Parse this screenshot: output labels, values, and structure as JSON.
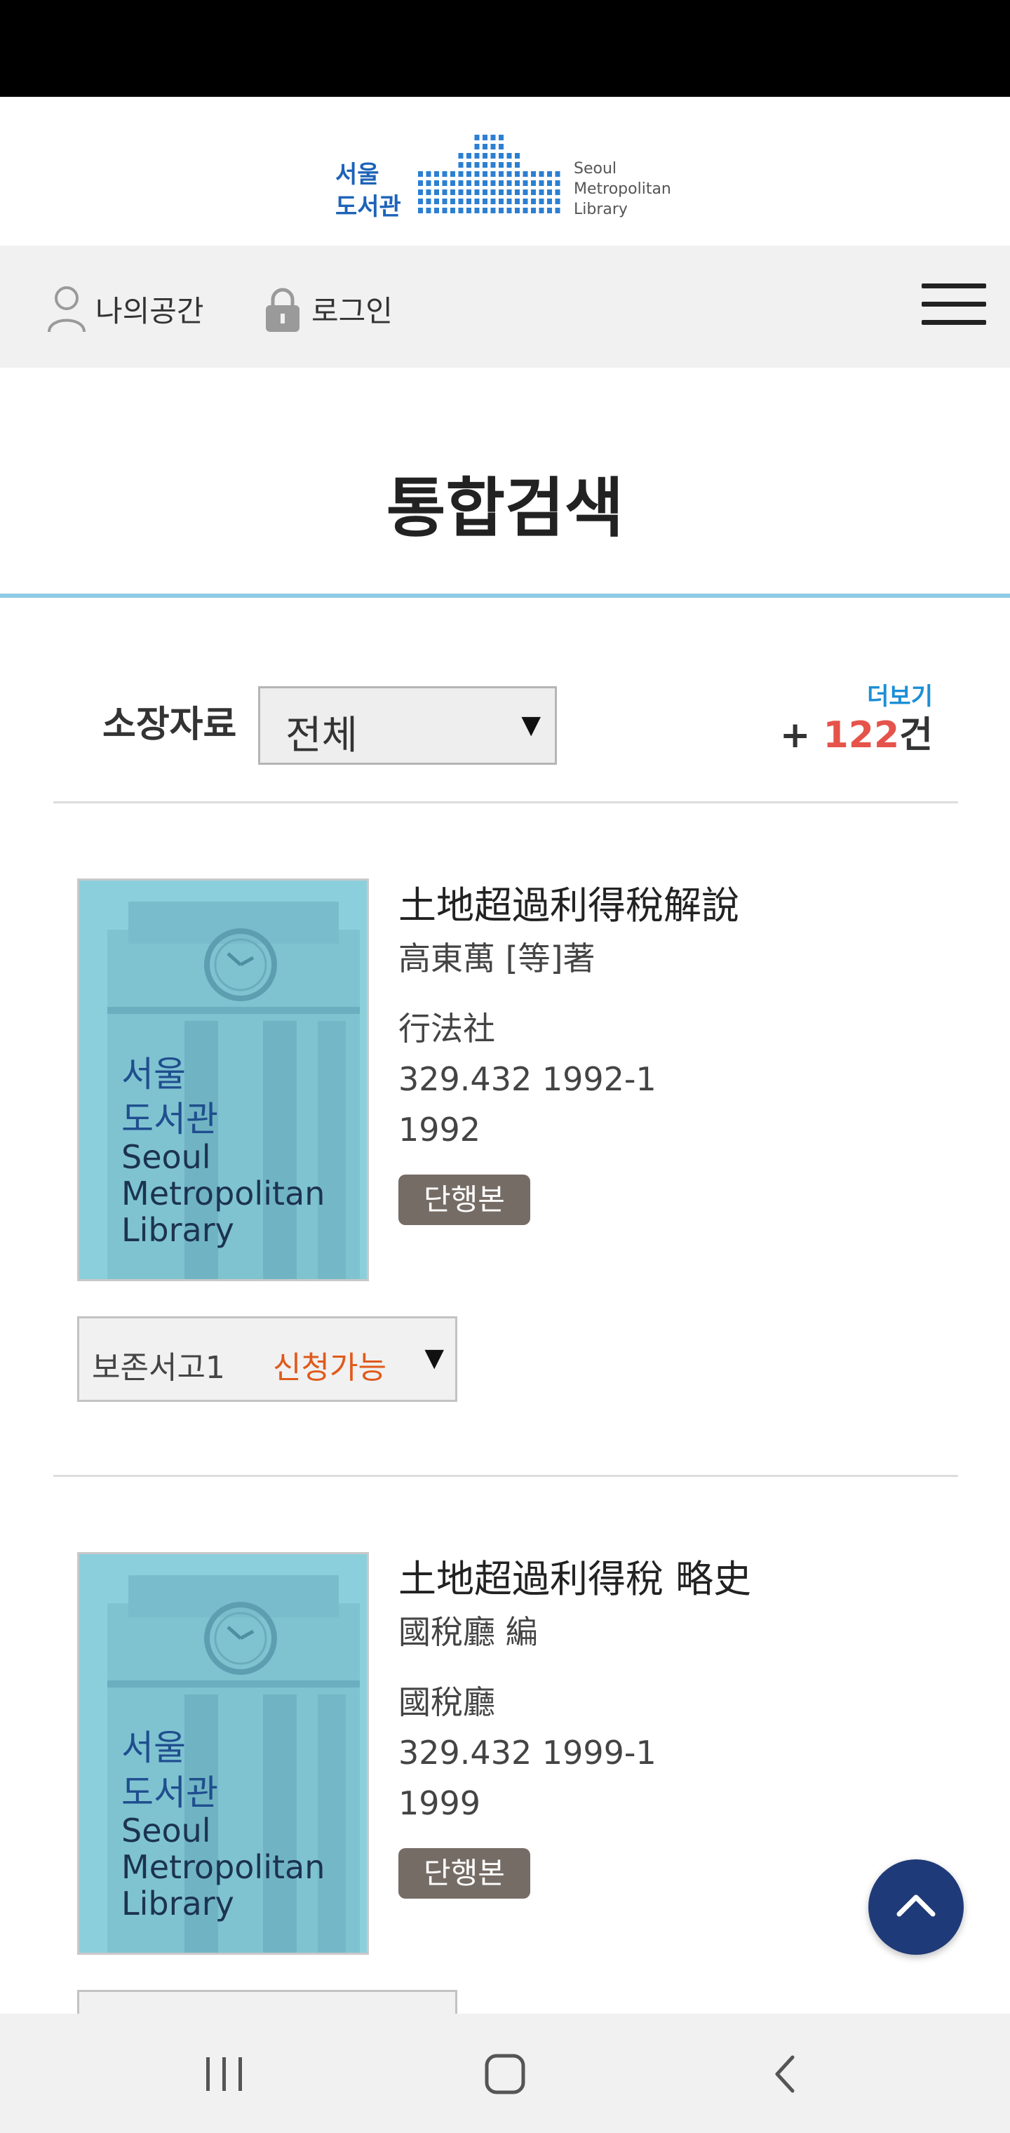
{
  "logo": {
    "kr_line1": "서울",
    "kr_line2": "도서관",
    "en_line1": "Seoul",
    "en_line2": "Metropolitan",
    "en_line3": "Library"
  },
  "util": {
    "my_space": "나의공간",
    "login": "로그인",
    "menu_icon": "hamburger-icon"
  },
  "page_title": "통합검색",
  "filter": {
    "label": "소장자료",
    "selected": "전체",
    "more_label": "더보기",
    "count_prefix": "+ ",
    "count": "122",
    "count_suffix": "건"
  },
  "cover": {
    "kr_line1": "서울",
    "kr_line2": "도서관",
    "en_line1": "Seoul",
    "en_line2": "Metropolitan",
    "en_line3": "Library"
  },
  "books": [
    {
      "title": "土地超過利得稅解說",
      "author": "高東萬 [等]著",
      "publisher": "行法社",
      "call_number": "329.432 1992-1",
      "year": "1992",
      "type": "단행본",
      "holding_location": "보존서고1",
      "holding_status": "신청가능"
    },
    {
      "title": "土地超過利得稅 略史",
      "author": "國稅廳 編",
      "publisher": "國稅廳",
      "call_number": "329.432 1999-1",
      "year": "1999",
      "type": "단행본"
    }
  ],
  "colors": {
    "accent_blue": "#1c8fd6",
    "count_red": "#e5534b",
    "status_orange": "#e05a1b",
    "badge_gray": "#766c66",
    "scroll_top_navy": "#1f3a78"
  },
  "nav_bar": {
    "icons": [
      "recent-apps-icon",
      "home-icon",
      "back-icon"
    ]
  }
}
